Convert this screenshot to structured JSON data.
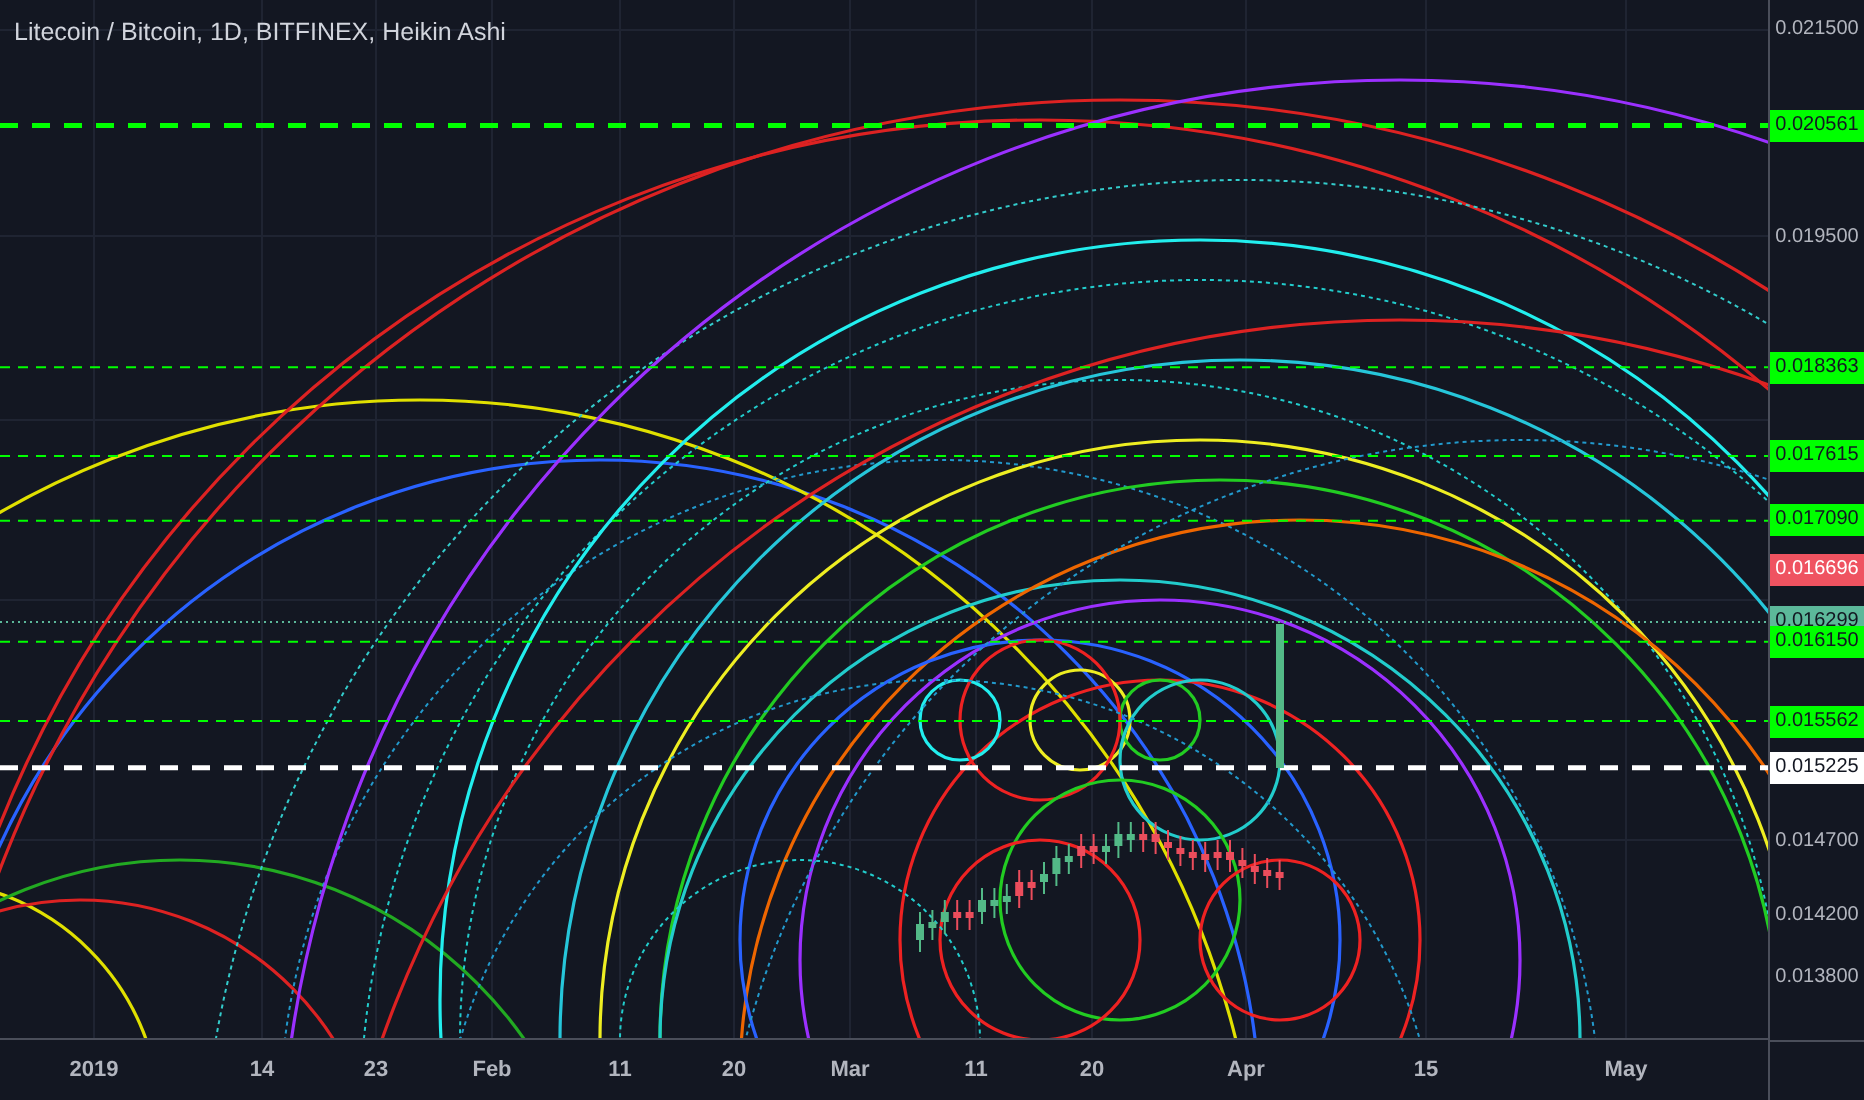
{
  "chart": {
    "title": "Litecoin / Bitcoin, 1D, BITFINEX, Heikin Ashi"
  },
  "price_axis": [
    {
      "label": "0.021500",
      "kind": "tick"
    },
    {
      "label": "0.020561",
      "kind": "major",
      "color": "#00ff00"
    },
    {
      "label": "0.019500",
      "kind": "tick"
    },
    {
      "label": "0.018363",
      "kind": "level",
      "color": "#00ff00"
    },
    {
      "label": "0.017615",
      "kind": "level",
      "color": "#00ff00"
    },
    {
      "label": "0.017090",
      "kind": "level",
      "color": "#00ff00"
    },
    {
      "label": "0.016696",
      "kind": "marker",
      "color": "#ef5361"
    },
    {
      "label": "0.016299",
      "kind": "price",
      "color": "#5cb89a"
    },
    {
      "label": "0.016150",
      "kind": "level",
      "color": "#00ff00"
    },
    {
      "label": "0.015562",
      "kind": "level",
      "color": "#00ff00"
    },
    {
      "label": "0.015225",
      "kind": "major",
      "color": "#ffffff"
    },
    {
      "label": "0.014700",
      "kind": "tick"
    },
    {
      "label": "0.014200",
      "kind": "tick"
    },
    {
      "label": "0.013800",
      "kind": "tick"
    }
  ],
  "time_axis": [
    "2019",
    "14",
    "23",
    "Feb",
    "11",
    "20",
    "Mar",
    "11",
    "20",
    "Apr",
    "15",
    "May"
  ]
}
